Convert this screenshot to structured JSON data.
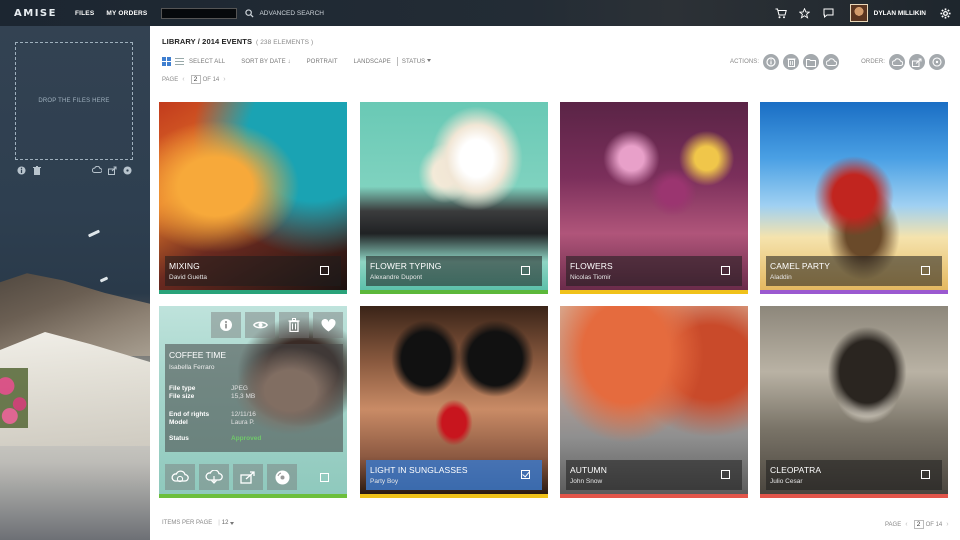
{
  "app": {
    "logo": "AMISE"
  },
  "topnav": {
    "files": "FILES",
    "orders": "MY ORDERS",
    "search_value": "",
    "advanced_search": "ADVANCED SEARCH",
    "user_name": "DYLAN MILLIKIN"
  },
  "sidebar": {
    "drop_text": "DROP THE FILES HERE"
  },
  "main": {
    "breadcrumb": "LIBRARY / 2014 EVENTS",
    "count": "( 238 ELEMENTS )",
    "toolbar": {
      "select_all": "SELECT ALL",
      "sort": "SORT BY DATE",
      "portrait": "PORTRAIT",
      "landscape": "LANDSCAPE",
      "status": "STATUS"
    },
    "actions_label": "ACTIONS:",
    "order_label": "ORDER:",
    "pager_top": {
      "label": "PAGE",
      "current": "2",
      "of": "OF 14"
    },
    "pager_bottom": {
      "label": "PAGE",
      "current": "2",
      "of": "OF 14"
    },
    "items_per_page": {
      "label": "ITEMS PER PAGE",
      "value": "12"
    }
  },
  "cards": [
    {
      "title": "MIXING",
      "author": "David Guetta",
      "stripe": "#2aa37a",
      "checked": false
    },
    {
      "title": "FLOWER TYPING",
      "author": "Alexandre Dupont",
      "stripe": "#5cb83a",
      "checked": false
    },
    {
      "title": "FLOWERS",
      "author": "Nicolas Tiomir",
      "stripe": "#f0c21a",
      "checked": false
    },
    {
      "title": "CAMEL PARTY",
      "author": "Aladdin",
      "stripe": "#9b59d0",
      "checked": false
    },
    {
      "title": "COFFEE TIME",
      "author": "Isabella Ferraro",
      "stripe": "#6cbf3c",
      "checked": false,
      "details": {
        "file_type_label": "File type",
        "file_type": "JPEG",
        "file_size_label": "File size",
        "file_size": "15,3 MB",
        "end_rights_label": "End of rights",
        "end_rights": "12/11/16",
        "model_label": "Model",
        "model": "Laura P.",
        "status_label": "Status",
        "status": "Approved"
      }
    },
    {
      "title": "LIGHT IN SUNGLASSES",
      "author": "Party Boy",
      "stripe": "#f0c21a",
      "checked": true
    },
    {
      "title": "AUTUMN",
      "author": "John Snow",
      "stripe": "#e2554a",
      "checked": false
    },
    {
      "title": "CLEOPATRA",
      "author": "Julio Cesar",
      "stripe": "#e2554a",
      "checked": false
    }
  ],
  "icons": {
    "cart": "cart-icon",
    "star": "star-icon",
    "chat": "chat-icon",
    "settings": "gear-icon",
    "info": "info-icon",
    "trash": "trash-icon",
    "folder": "folder-icon",
    "cloud_upload": "cloud-upload-icon",
    "cloud_download": "cloud-download-icon",
    "share": "share-icon",
    "eye": "eye-icon",
    "heart": "heart-icon",
    "disc": "disc-icon"
  },
  "colors": {
    "accent_blue": "#3f7fd0",
    "approved": "#6fc86a"
  }
}
